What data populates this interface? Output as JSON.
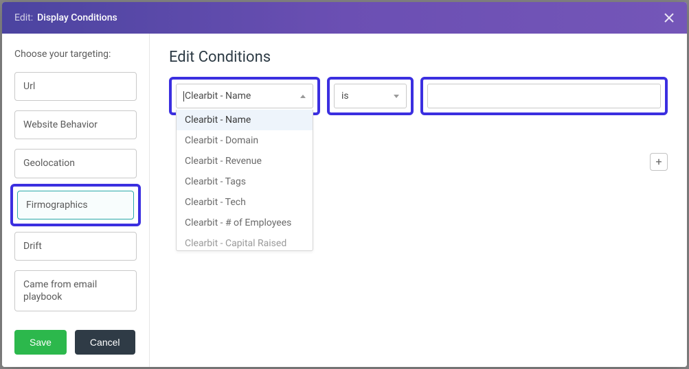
{
  "header": {
    "label": "Edit:",
    "value": "Display Conditions"
  },
  "sidebar": {
    "title": "Choose your targeting:",
    "items": [
      {
        "label": "Url",
        "selected": false
      },
      {
        "label": "Website Behavior",
        "selected": false
      },
      {
        "label": "Geolocation",
        "selected": false
      },
      {
        "label": "Firmographics",
        "selected": true
      },
      {
        "label": "Drift",
        "selected": false
      },
      {
        "label": "Came from email playbook",
        "selected": false
      }
    ]
  },
  "footer": {
    "save": "Save",
    "cancel": "Cancel"
  },
  "main": {
    "title": "Edit Conditions",
    "field_selected": "Clearbit - Name",
    "operator_selected": "is",
    "value_input": "",
    "field_options": [
      "Clearbit - Name",
      "Clearbit - Domain",
      "Clearbit - Revenue",
      "Clearbit - Tags",
      "Clearbit - Tech",
      "Clearbit - # of Employees",
      "Clearbit - Capital Raised"
    ],
    "add_label": "+"
  }
}
